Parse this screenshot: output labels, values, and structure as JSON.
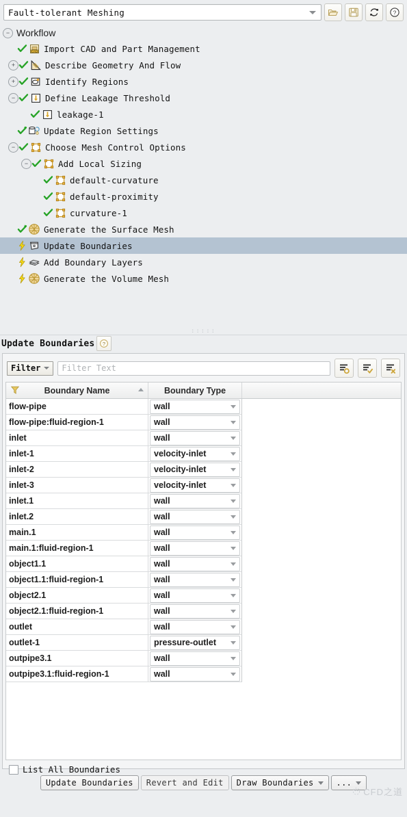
{
  "topbar": {
    "workflow_value": "Fault-tolerant Meshing",
    "buttons": [
      {
        "name": "open-folder-icon",
        "label": "Open"
      },
      {
        "name": "save-icon",
        "label": "Save"
      },
      {
        "name": "reset-workflow-icon",
        "label": "Reset Workflow"
      },
      {
        "name": "help-icon",
        "label": "Help"
      }
    ]
  },
  "tree": {
    "root_label": "Workflow",
    "root_expander": "−",
    "nodes": [
      {
        "indent": 1,
        "expander": "",
        "state": "done",
        "icon": "cad-import-icon",
        "label": "Import CAD and Part Management"
      },
      {
        "indent": 1,
        "expander": "+",
        "state": "done",
        "icon": "geometry-icon",
        "label": "Describe Geometry And Flow"
      },
      {
        "indent": 1,
        "expander": "+",
        "state": "done",
        "icon": "regions-icon",
        "label": "Identify Regions"
      },
      {
        "indent": 1,
        "expander": "−",
        "state": "done",
        "icon": "leakage-icon",
        "label": "Define Leakage Threshold"
      },
      {
        "indent": 2,
        "expander": "",
        "state": "done",
        "icon": "leakage-icon",
        "label": "leakage-1"
      },
      {
        "indent": 1,
        "expander": "",
        "state": "updated",
        "icon": "region-settings-icon",
        "label": "Update Region Settings"
      },
      {
        "indent": 1,
        "expander": "−",
        "state": "done",
        "icon": "sizing-icon",
        "label": "Choose Mesh Control Options"
      },
      {
        "indent": 2,
        "expander": "−",
        "state": "done",
        "icon": "sizing-icon",
        "label": "Add Local Sizing"
      },
      {
        "indent": 3,
        "expander": "",
        "state": "done",
        "icon": "sizing-icon",
        "label": "default-curvature"
      },
      {
        "indent": 3,
        "expander": "",
        "state": "done",
        "icon": "sizing-icon",
        "label": "default-proximity"
      },
      {
        "indent": 3,
        "expander": "",
        "state": "done",
        "icon": "sizing-icon",
        "label": "curvature-1"
      },
      {
        "indent": 1,
        "expander": "",
        "state": "updated",
        "icon": "surface-mesh-icon",
        "label": "Generate the Surface Mesh"
      },
      {
        "indent": 1,
        "expander": "",
        "state": "pending",
        "icon": "boundaries-icon",
        "label": "Update Boundaries",
        "selected": true
      },
      {
        "indent": 1,
        "expander": "",
        "state": "pending",
        "icon": "boundary-layers-icon",
        "label": "Add Boundary Layers"
      },
      {
        "indent": 1,
        "expander": "",
        "state": "pending",
        "icon": "volume-mesh-icon",
        "label": "Generate the Volume Mesh"
      }
    ]
  },
  "panel": {
    "title": "Update Boundaries",
    "help_glyph": "?",
    "filter": {
      "button_label": "Filter",
      "input_value": "",
      "input_placeholder": "Filter Text",
      "tools": [
        {
          "name": "select-none-icon",
          "label": "Deselect All"
        },
        {
          "name": "select-checked-icon",
          "label": "Select Checked"
        },
        {
          "name": "clear-selection-icon",
          "label": "Clear Selection"
        }
      ]
    },
    "table": {
      "columns": [
        "Boundary Name",
        "Boundary Type"
      ],
      "sort_column": "Boundary Name",
      "sort_direction": "asc",
      "type_options": [
        "wall",
        "velocity-inlet",
        "pressure-outlet"
      ],
      "rows": [
        {
          "name": "flow-pipe",
          "type": "wall"
        },
        {
          "name": "flow-pipe:fluid-region-1",
          "type": "wall"
        },
        {
          "name": "inlet",
          "type": "wall"
        },
        {
          "name": "inlet-1",
          "type": "velocity-inlet"
        },
        {
          "name": "inlet-2",
          "type": "velocity-inlet"
        },
        {
          "name": "inlet-3",
          "type": "velocity-inlet"
        },
        {
          "name": "inlet.1",
          "type": "wall"
        },
        {
          "name": "inlet.2",
          "type": "wall"
        },
        {
          "name": "main.1",
          "type": "wall"
        },
        {
          "name": "main.1:fluid-region-1",
          "type": "wall"
        },
        {
          "name": "object1.1",
          "type": "wall"
        },
        {
          "name": "object1.1:fluid-region-1",
          "type": "wall"
        },
        {
          "name": "object2.1",
          "type": "wall"
        },
        {
          "name": "object2.1:fluid-region-1",
          "type": "wall"
        },
        {
          "name": "outlet",
          "type": "wall"
        },
        {
          "name": "outlet-1",
          "type": "pressure-outlet"
        },
        {
          "name": "outpipe3.1",
          "type": "wall"
        },
        {
          "name": "outpipe3.1:fluid-region-1",
          "type": "wall"
        }
      ]
    },
    "list_all": {
      "label": "List All Boundaries",
      "checked": false
    }
  },
  "footer": {
    "buttons": [
      {
        "label": "Update Boundaries",
        "kind": "primary",
        "name": "update-boundaries-button"
      },
      {
        "label": "Revert and Edit",
        "kind": "flat",
        "name": "revert-and-edit-button"
      },
      {
        "label": "Draw Boundaries",
        "kind": "dropdown",
        "name": "draw-boundaries-button"
      },
      {
        "label": "...",
        "kind": "dropdown",
        "name": "more-options-button"
      }
    ]
  },
  "watermark": {
    "text": "CFD之道"
  },
  "colors": {
    "selection": "#b4c3d2",
    "check_green": "#2aa32a",
    "bolt_yellow": "#f4d411",
    "panel_bg": "#eceef0",
    "accent_gold": "#d9b44a"
  }
}
